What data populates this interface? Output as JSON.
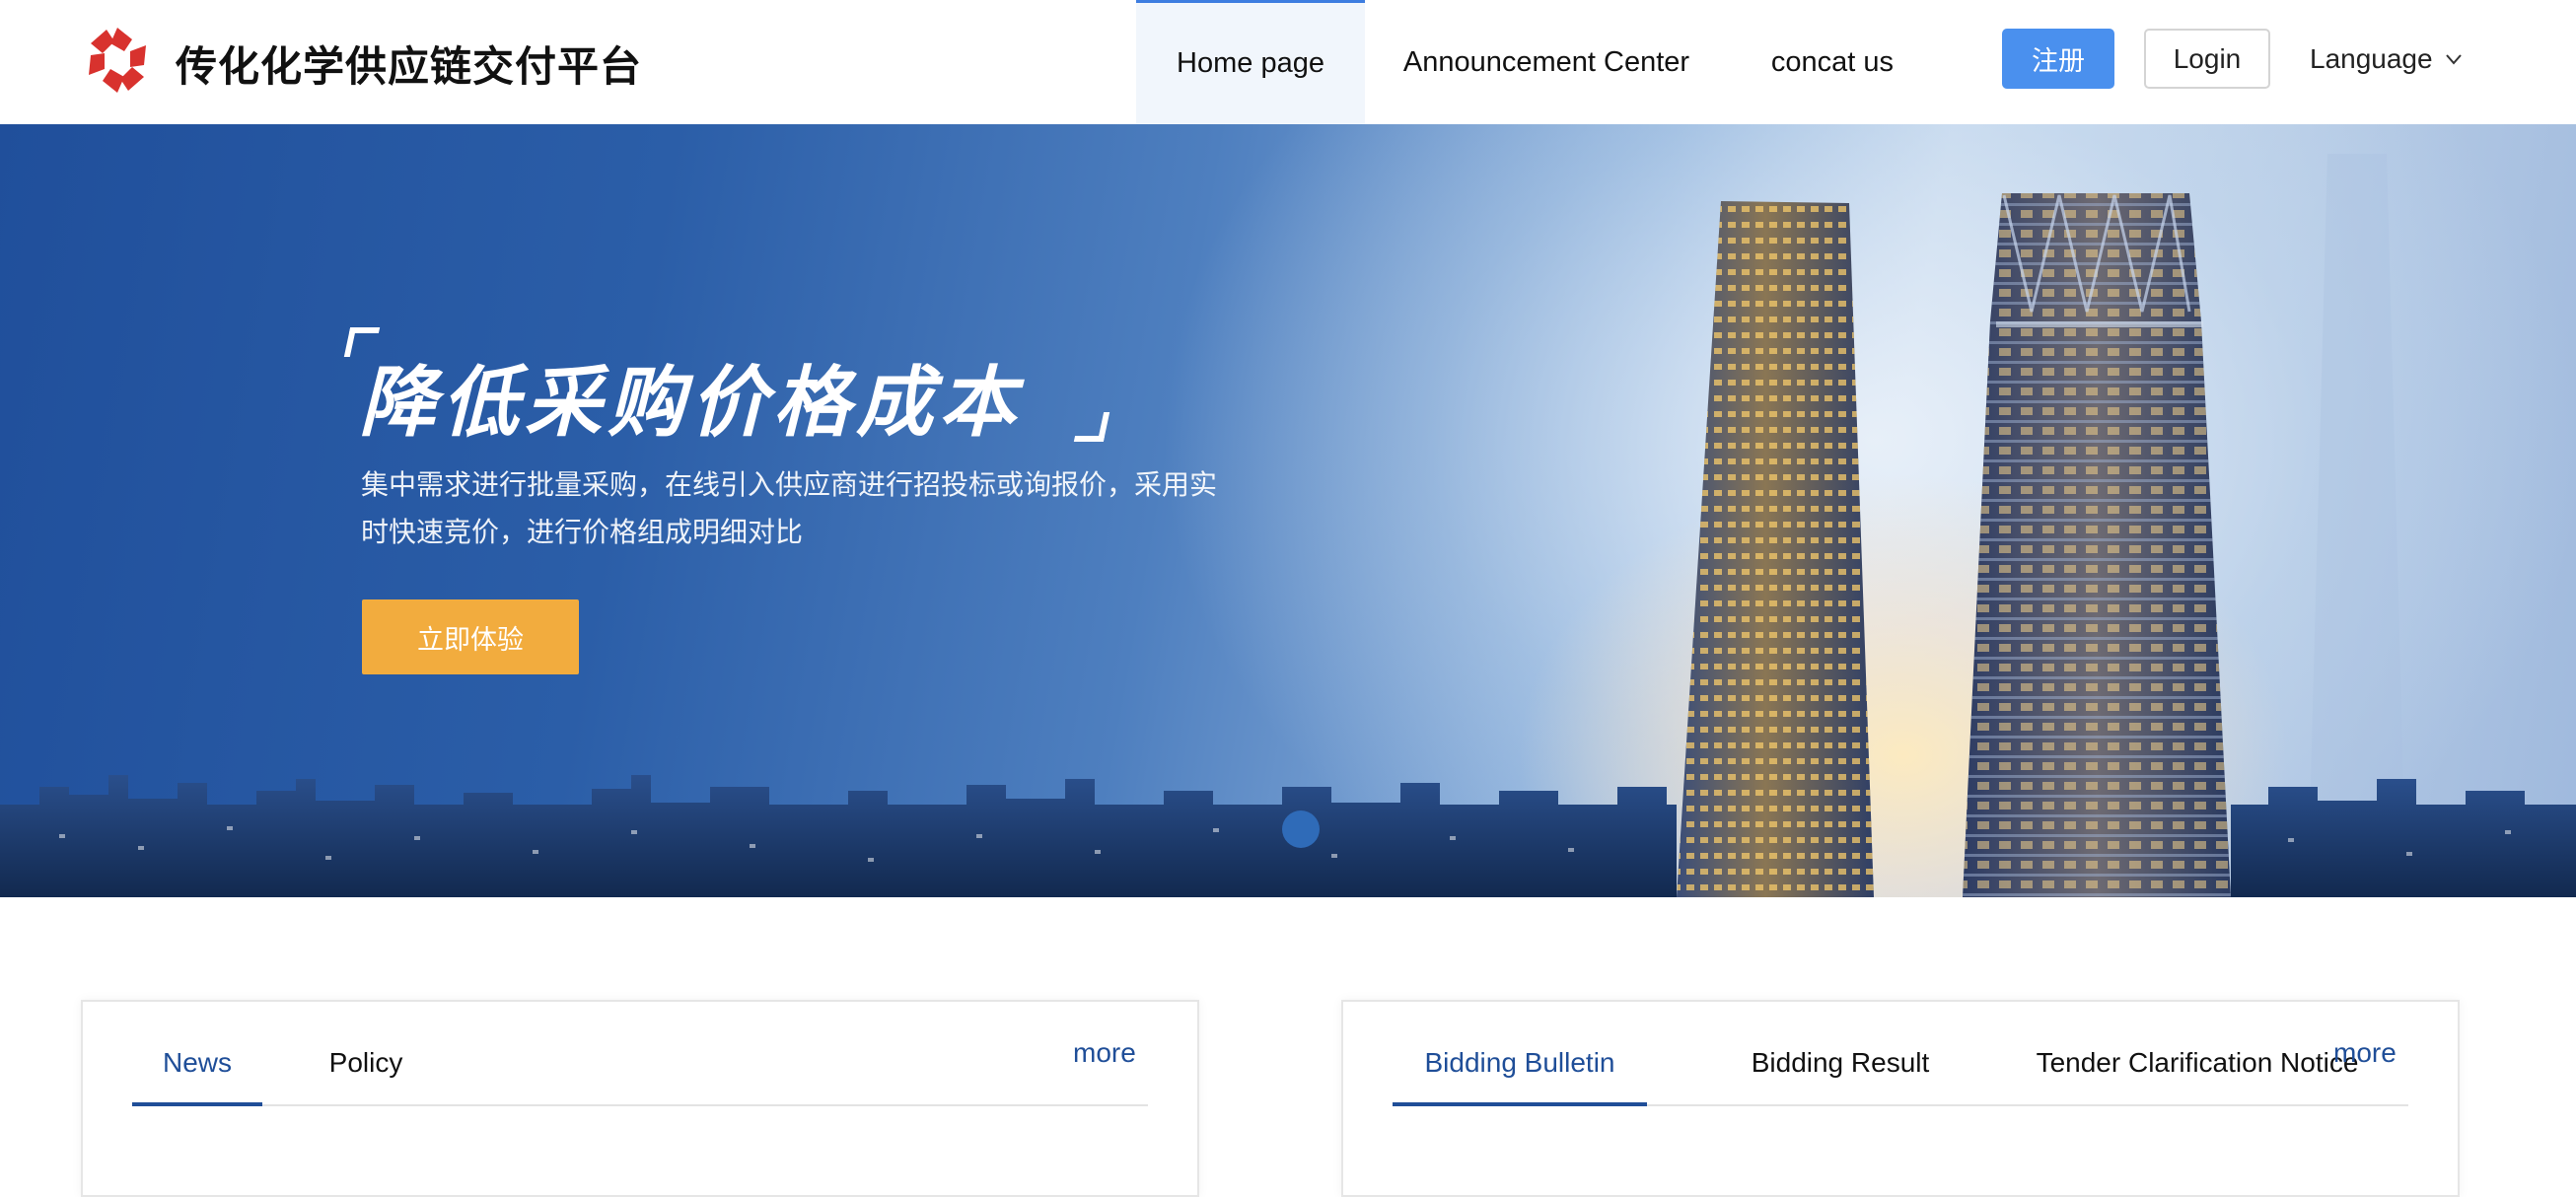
{
  "header": {
    "brand_title": "传化化学供应链交付平台",
    "logo_icon": "tuhu-logo-icon",
    "brand_color": "#d8322e",
    "nav": [
      {
        "label": "Home page",
        "active": true
      },
      {
        "label": "Announcement Center",
        "active": false
      },
      {
        "label": "concat us",
        "active": false
      }
    ],
    "register_label": "注册",
    "login_label": "Login",
    "language_label": "Language",
    "language_icon": "chevron-down-icon",
    "accent_color": "#4a90ee"
  },
  "hero": {
    "headline": "降低采购价格成本",
    "description": "集中需求进行批量采购，在线引入供应商进行招投标或询报价，采用实时快速竞价，进行价格组成明细对比",
    "cta_label": "立即体验",
    "cta_color": "#f2ac3e",
    "active_slide": 1
  },
  "panels": {
    "left": {
      "tabs": [
        {
          "label": "News",
          "active": true
        },
        {
          "label": "Policy",
          "active": false
        }
      ],
      "more_label": "more"
    },
    "right": {
      "tabs": [
        {
          "label": "Bidding Bulletin",
          "active": true
        },
        {
          "label": "Bidding Result",
          "active": false
        },
        {
          "label": "Tender Clarification Notice",
          "active": false
        }
      ],
      "more_label": "more"
    },
    "active_tab_color": "#1f4e98"
  }
}
